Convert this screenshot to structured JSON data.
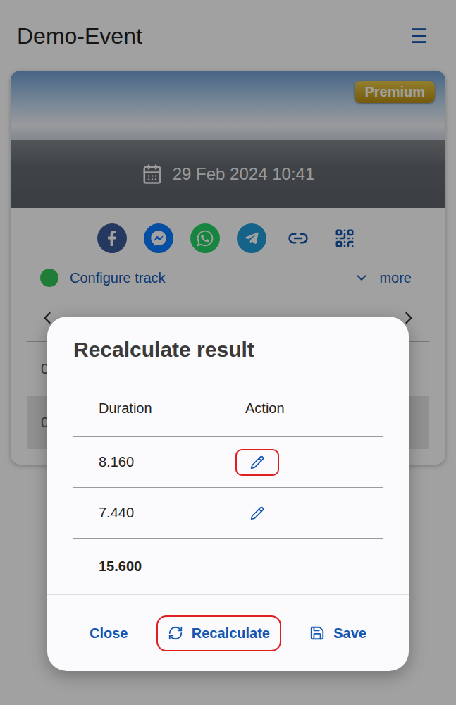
{
  "header": {
    "title": "Demo-Event",
    "menu": "☰"
  },
  "event_card": {
    "badge": "Premium",
    "date": "29 Feb 2024 10:41",
    "status": {
      "label": "Configure track"
    },
    "more": "more"
  },
  "list_rows": [
    {
      "text": "0",
      "selected": false
    },
    {
      "text": "0",
      "selected": true
    }
  ],
  "dialog": {
    "title": "Recalculate result",
    "columns": [
      "Duration",
      "Action"
    ],
    "rows": [
      {
        "duration": "8.160",
        "highlighted": true
      },
      {
        "duration": "7.440",
        "highlighted": false
      }
    ],
    "total": "15.600",
    "buttons": [
      {
        "label": "Close",
        "kind": "plain",
        "highlighted": false
      },
      {
        "label": "Recalculate",
        "kind": "recalculate",
        "highlighted": true
      },
      {
        "label": "Save",
        "kind": "save",
        "highlighted": false
      }
    ]
  }
}
